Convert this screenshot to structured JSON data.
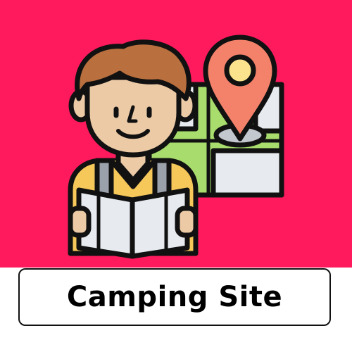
{
  "card": {
    "title": "Camping Site",
    "background_color": "#ff1a5e"
  },
  "illustration": {
    "icon": "person-with-map-and-location-pin-icon"
  }
}
